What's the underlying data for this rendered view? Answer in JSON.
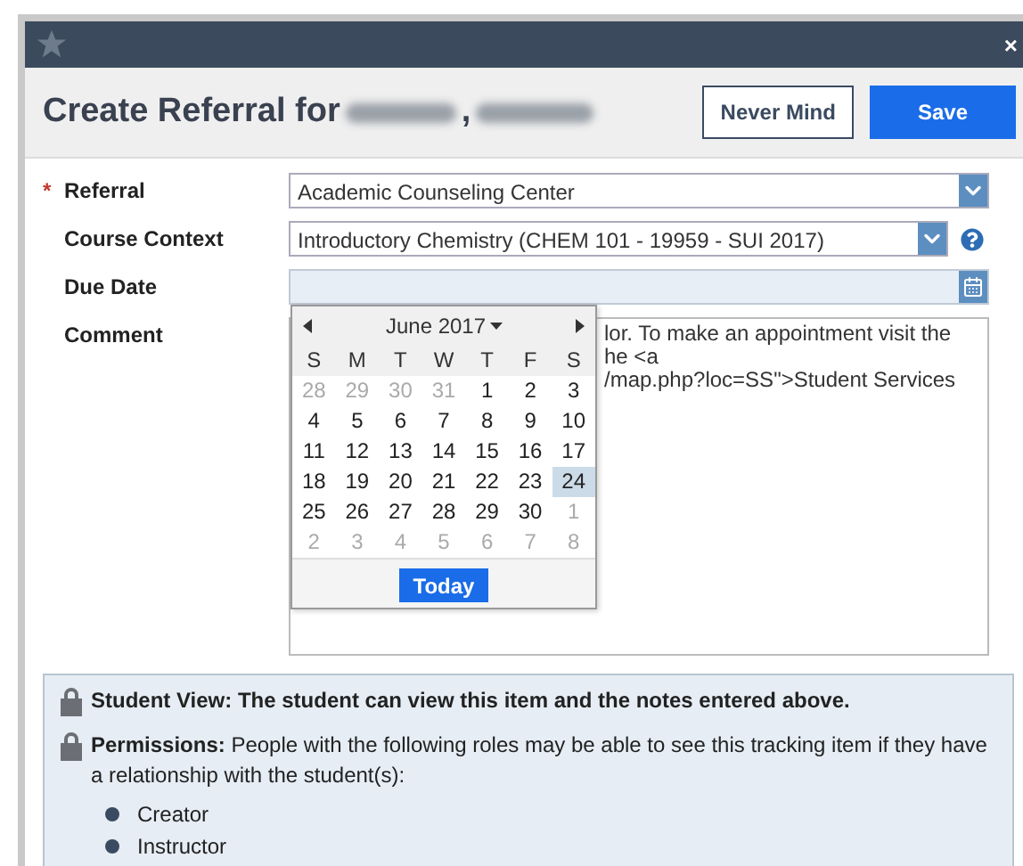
{
  "window": {
    "close": "×"
  },
  "header": {
    "title": "Create Referral for",
    "name_separator": ",",
    "buttons": [
      {
        "label": "Never Mind",
        "kind": "secondary"
      },
      {
        "label": "Save",
        "kind": "primary"
      }
    ]
  },
  "required_mark": "*",
  "fields": [
    {
      "label": "Referral",
      "kind": "select",
      "required": true,
      "value": "Academic Counseling Center",
      "help": false
    },
    {
      "label": "Course Context",
      "kind": "select",
      "required": false,
      "value": "Introductory Chemistry (CHEM 101 - 19959 - SUI 2017)",
      "help": true
    },
    {
      "label": "Due Date",
      "kind": "date",
      "required": false,
      "help": false
    },
    {
      "label": "Comment",
      "kind": "textarea",
      "required": false,
      "lines": [
        "lor. To make an appointment visit the",
        "he <a",
        "/map.php?loc=SS\">Student Services"
      ],
      "help": false
    }
  ],
  "calendar": {
    "month": "June 2017",
    "weekdays": [
      "S",
      "M",
      "T",
      "W",
      "T",
      "F",
      "S"
    ],
    "days": [
      {
        "d": "28",
        "other": true,
        "selected": false
      },
      {
        "d": "29",
        "other": true,
        "selected": false
      },
      {
        "d": "30",
        "other": true,
        "selected": false
      },
      {
        "d": "31",
        "other": true,
        "selected": false
      },
      {
        "d": "1",
        "other": false,
        "selected": false
      },
      {
        "d": "2",
        "other": false,
        "selected": false
      },
      {
        "d": "3",
        "other": false,
        "selected": false
      },
      {
        "d": "4",
        "other": false,
        "selected": false
      },
      {
        "d": "5",
        "other": false,
        "selected": false
      },
      {
        "d": "6",
        "other": false,
        "selected": false
      },
      {
        "d": "7",
        "other": false,
        "selected": false
      },
      {
        "d": "8",
        "other": false,
        "selected": false
      },
      {
        "d": "9",
        "other": false,
        "selected": false
      },
      {
        "d": "10",
        "other": false,
        "selected": false
      },
      {
        "d": "11",
        "other": false,
        "selected": false
      },
      {
        "d": "12",
        "other": false,
        "selected": false
      },
      {
        "d": "13",
        "other": false,
        "selected": false
      },
      {
        "d": "14",
        "other": false,
        "selected": false
      },
      {
        "d": "15",
        "other": false,
        "selected": false
      },
      {
        "d": "16",
        "other": false,
        "selected": false
      },
      {
        "d": "17",
        "other": false,
        "selected": false
      },
      {
        "d": "18",
        "other": false,
        "selected": false
      },
      {
        "d": "19",
        "other": false,
        "selected": false
      },
      {
        "d": "20",
        "other": false,
        "selected": false
      },
      {
        "d": "21",
        "other": false,
        "selected": false
      },
      {
        "d": "22",
        "other": false,
        "selected": false
      },
      {
        "d": "23",
        "other": false,
        "selected": false
      },
      {
        "d": "24",
        "other": false,
        "selected": true
      },
      {
        "d": "25",
        "other": false,
        "selected": false
      },
      {
        "d": "26",
        "other": false,
        "selected": false
      },
      {
        "d": "27",
        "other": false,
        "selected": false
      },
      {
        "d": "28",
        "other": false,
        "selected": false
      },
      {
        "d": "29",
        "other": false,
        "selected": false
      },
      {
        "d": "30",
        "other": false,
        "selected": false
      },
      {
        "d": "1",
        "other": true,
        "selected": false
      },
      {
        "d": "2",
        "other": true,
        "selected": false
      },
      {
        "d": "3",
        "other": true,
        "selected": false
      },
      {
        "d": "4",
        "other": true,
        "selected": false
      },
      {
        "d": "5",
        "other": true,
        "selected": false
      },
      {
        "d": "6",
        "other": true,
        "selected": false
      },
      {
        "d": "7",
        "other": true,
        "selected": false
      },
      {
        "d": "8",
        "other": true,
        "selected": false
      }
    ],
    "today": "Today"
  },
  "notes": [
    {
      "text": "Student View: The student can view this item and the notes entered above.",
      "bold": true
    },
    {
      "text": "**Permissions:** People with the following roles may be able to see this tracking item if they have a relationship with the student(s):",
      "bold": false,
      "roles": [
        "Creator",
        "Instructor"
      ]
    }
  ]
}
